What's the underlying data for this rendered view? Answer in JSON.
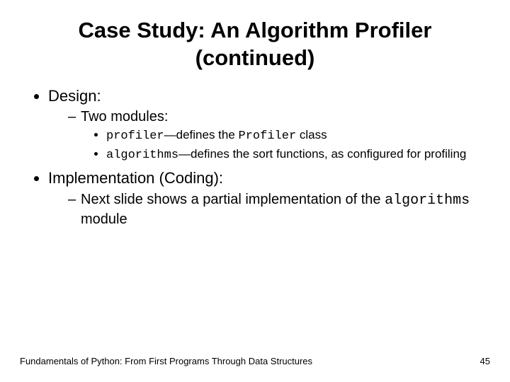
{
  "title_line1": "Case Study: An Algorithm Profiler",
  "title_line2": "(continued)",
  "b1": "Design:",
  "b1_1": "Two modules:",
  "b1_1_1_code": "profiler",
  "b1_1_1_mid": "—defines the ",
  "b1_1_1_code2": "Profiler",
  "b1_1_1_tail": " class",
  "b1_1_2_code": "algorithms",
  "b1_1_2_tail": "—defines the sort functions, as configured for profiling",
  "b2": "Implementation (Coding):",
  "b2_1_pre": "Next slide shows a partial implementation of the ",
  "b2_1_code": "algorithms",
  "b2_1_tail": " module",
  "footer_left": "Fundamentals of Python: From First Programs Through Data Structures",
  "footer_right": "45"
}
